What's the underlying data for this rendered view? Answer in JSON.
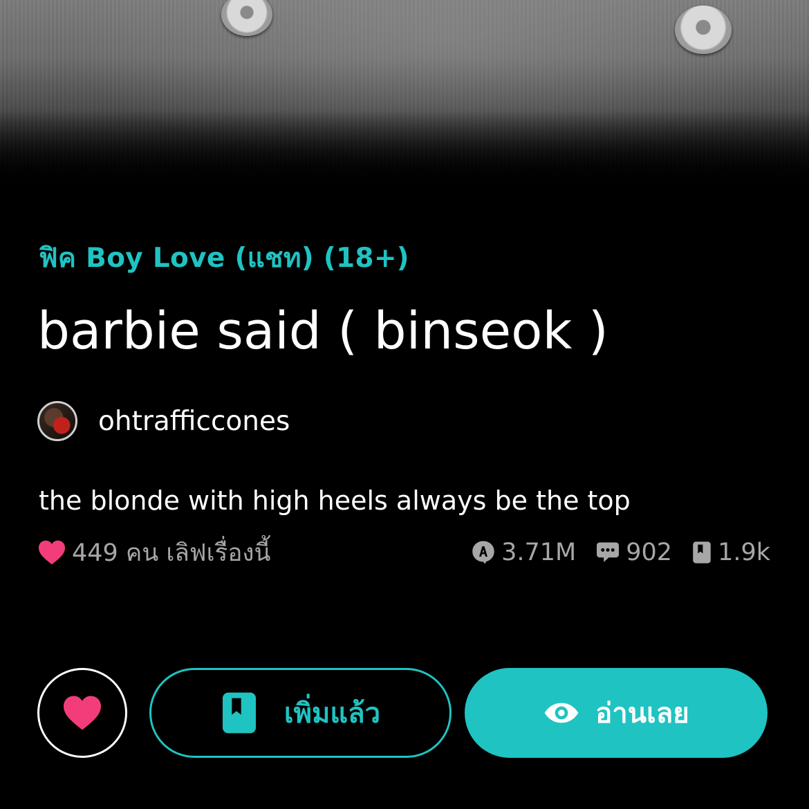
{
  "story": {
    "category": "ฟิค Boy Love (แชท) (18+)",
    "title": "barbie said ( binseok )",
    "author": "ohtrafficcones",
    "description": "the blonde with high heels always be the top"
  },
  "stats": {
    "love_text": "449 คน เลิฟเรื่องนี้",
    "reads": "3.71M",
    "comments": "902",
    "library_adds": "1.9k"
  },
  "actions": {
    "library_label": "เพิ่มแล้ว",
    "read_label": "อ่านเลย"
  },
  "icons": {
    "love": "heart-icon",
    "reads": "reads-badge-icon",
    "comments": "comment-bubble-icon",
    "library": "bookmark-book-icon",
    "read": "eye-icon"
  },
  "colors": {
    "accent": "#1fc3c2",
    "heart": "#f23d7a",
    "muted": "#a7a7a7",
    "background": "#000000"
  }
}
